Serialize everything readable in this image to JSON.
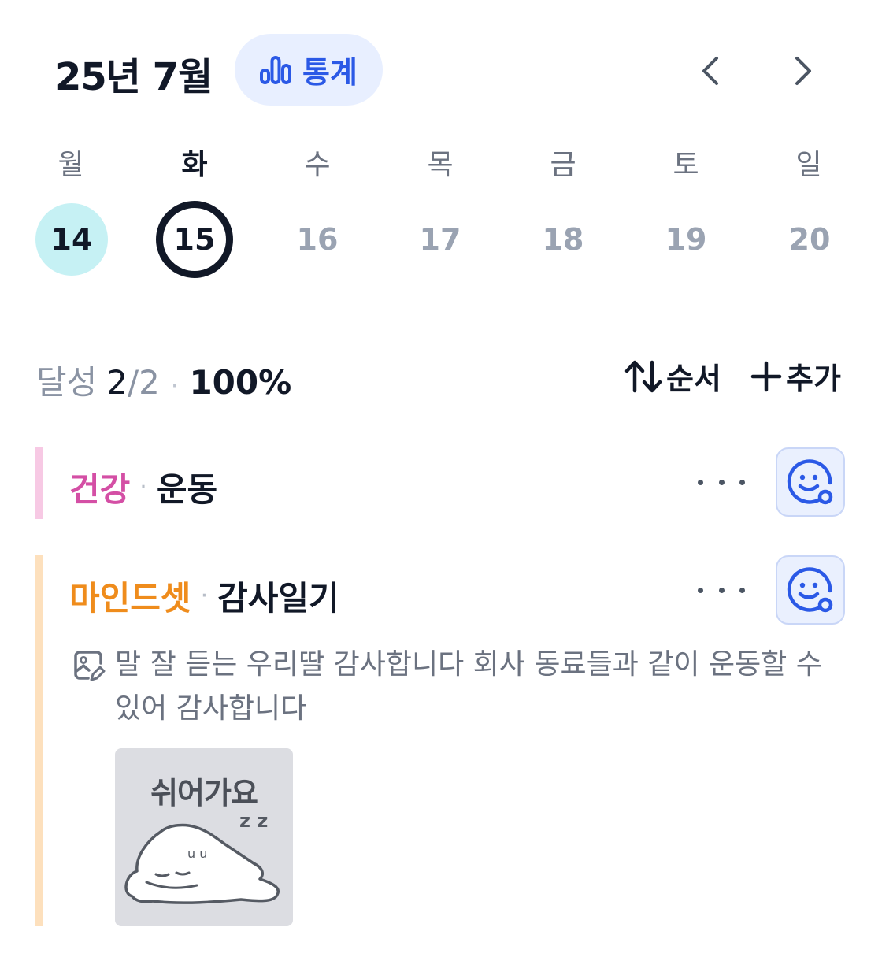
{
  "header": {
    "month_title": "25년 7월",
    "stats_label": "통계",
    "prev_icon": "chevron-left-icon",
    "next_icon": "chevron-right-icon",
    "accent": "#2b59e6"
  },
  "week": {
    "weekdays": [
      "월",
      "화",
      "수",
      "목",
      "금",
      "토",
      "일"
    ],
    "days": [
      "14",
      "15",
      "16",
      "17",
      "18",
      "19",
      "20"
    ],
    "active_index": 1,
    "completed_index": 0
  },
  "summary": {
    "label": "달성",
    "done": "2",
    "slash": "/",
    "total": "2",
    "separator": "·",
    "percent": "100%",
    "sort_label": "순서",
    "add_label": "추가"
  },
  "habits": [
    {
      "category": "건강",
      "category_color": "#d44fa5",
      "bar_color": "#f7c9e4",
      "separator": "·",
      "name": "운동"
    },
    {
      "category": "마인드셋",
      "category_color": "#ef8c1c",
      "bar_color": "#fde0bd",
      "separator": "·",
      "name": "감사일기",
      "memo_line1": "말 잘 듣는 우리딸 감사합니다 회사 동료들과 같이 운동할 수",
      "memo_line2": "있어 감사합니다",
      "sticker_title": "쉬어가요",
      "sticker_zz": "z z",
      "sticker_eyes": "u u"
    }
  ]
}
